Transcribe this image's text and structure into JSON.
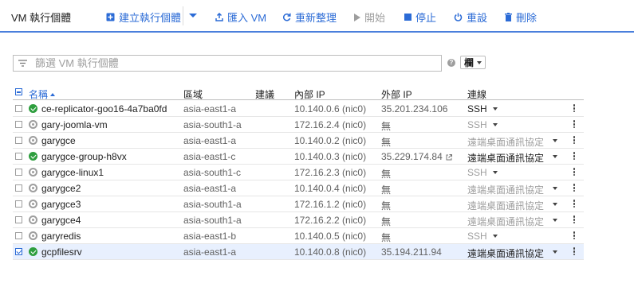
{
  "toolbar": {
    "title": "VM 執行個體",
    "create_label": "建立執行個體",
    "import_label": "匯入 VM",
    "refresh_label": "重新整理",
    "start_label": "開始",
    "stop_label": "停止",
    "reset_label": "重設",
    "delete_label": "刪除"
  },
  "filter": {
    "placeholder": "篩選 VM 執行個體",
    "columns_label": "欄"
  },
  "table": {
    "headers": {
      "name": "名稱",
      "zone": "區域",
      "recommendation": "建議",
      "internal_ip": "內部 IP",
      "external_ip": "外部 IP",
      "connect": "連線"
    },
    "rows": [
      {
        "name": "ce-replicator-goo16-4a7ba0fd",
        "status": "running",
        "zone": "asia-east1-a",
        "internal_ip": "10.140.0.6 (nic0)",
        "external_ip": "35.201.234.106",
        "connect": "SSH",
        "connect_enabled": true,
        "selected": false
      },
      {
        "name": "gary-joomla-vm",
        "status": "stopped",
        "zone": "asia-south1-a",
        "internal_ip": "172.16.2.4 (nic0)",
        "external_ip": "無",
        "connect": "SSH",
        "connect_enabled": false,
        "selected": false
      },
      {
        "name": "garygce",
        "status": "stopped",
        "zone": "asia-east1-a",
        "internal_ip": "10.140.0.2 (nic0)",
        "external_ip": "無",
        "connect": "遠端桌面通訊協定",
        "connect_enabled": false,
        "selected": false
      },
      {
        "name": "garygce-group-h8vx",
        "status": "running",
        "zone": "asia-east1-c",
        "internal_ip": "10.140.0.3 (nic0)",
        "external_ip": "35.229.174.84",
        "connect": "遠端桌面通訊協定",
        "connect_enabled": true,
        "selected": false
      },
      {
        "name": "garygce-linux1",
        "status": "stopped",
        "zone": "asia-south1-c",
        "internal_ip": "172.16.2.3 (nic0)",
        "external_ip": "無",
        "connect": "SSH",
        "connect_enabled": false,
        "selected": false
      },
      {
        "name": "garygce2",
        "status": "stopped",
        "zone": "asia-east1-a",
        "internal_ip": "10.140.0.4 (nic0)",
        "external_ip": "無",
        "connect": "遠端桌面通訊協定",
        "connect_enabled": false,
        "selected": false
      },
      {
        "name": "garygce3",
        "status": "stopped",
        "zone": "asia-south1-a",
        "internal_ip": "172.16.1.2 (nic0)",
        "external_ip": "無",
        "connect": "遠端桌面通訊協定",
        "connect_enabled": false,
        "selected": false
      },
      {
        "name": "garygce4",
        "status": "stopped",
        "zone": "asia-south1-a",
        "internal_ip": "172.16.2.2 (nic0)",
        "external_ip": "無",
        "connect": "遠端桌面通訊協定",
        "connect_enabled": false,
        "selected": false
      },
      {
        "name": "garyredis",
        "status": "stopped",
        "zone": "asia-east1-b",
        "internal_ip": "10.140.0.5 (nic0)",
        "external_ip": "無",
        "connect": "SSH",
        "connect_enabled": false,
        "selected": false
      },
      {
        "name": "gcpfilesrv",
        "status": "running",
        "zone": "asia-east1-a",
        "internal_ip": "10.140.0.8 (nic0)",
        "external_ip": "35.194.211.94",
        "connect": "遠端桌面通訊協定",
        "connect_enabled": true,
        "selected": true
      }
    ]
  },
  "colors": {
    "accent": "#2b6bd6",
    "running": "#2e9e3e",
    "stopped": "#9e9e9e",
    "selected_row": "#e8f0fe"
  },
  "icons": {
    "create": "add-box-icon",
    "import": "upload-icon",
    "refresh": "refresh-icon",
    "start": "play-icon",
    "stop": "stop-icon",
    "reset": "power-icon",
    "delete": "trash-icon",
    "filter": "filter-lines-icon",
    "help": "help-circle-icon",
    "external_link": "open-in-new-icon",
    "row_menu": "more-vert-icon"
  }
}
